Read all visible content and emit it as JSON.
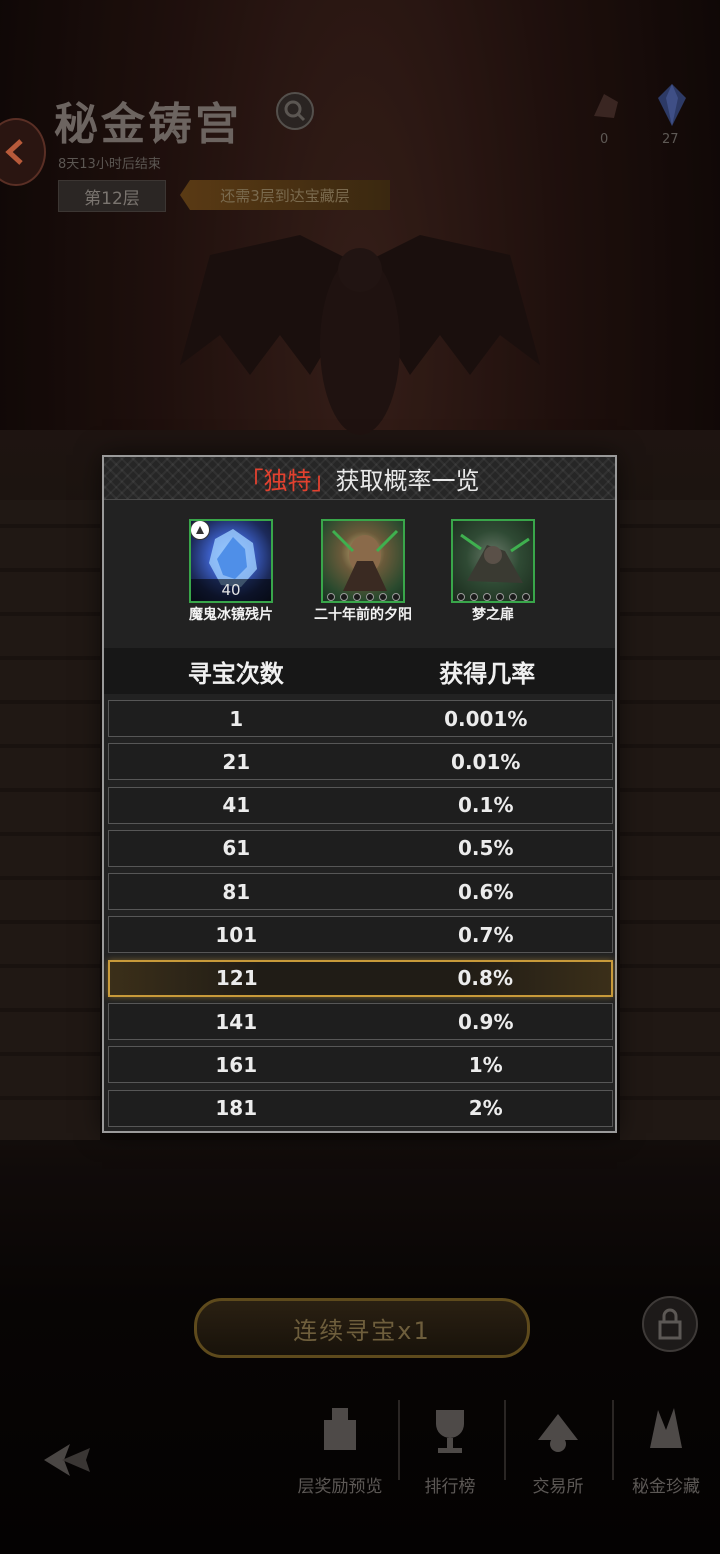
{
  "header": {
    "title": "秘金铸宫",
    "subtitle": "8天13小时后结束",
    "floor": "第12层",
    "floor_tip": "还需3层到达宝藏层",
    "resources": [
      {
        "icon": "ore-icon",
        "count": "0"
      },
      {
        "icon": "crystal-icon",
        "count": "27"
      }
    ]
  },
  "modal": {
    "title_highlight": "「独特」",
    "title_rest": "获取概率一览",
    "items": [
      {
        "name": "魔鬼冰镜残片",
        "quantity": "40",
        "icon": "ice-mirror-shard-icon"
      },
      {
        "name": "二十年前的夕阳",
        "icon": "sunset-card-icon"
      },
      {
        "name": "梦之扉",
        "icon": "dream-door-card-icon"
      }
    ],
    "column_headers": [
      "寻宝次数",
      "获得几率"
    ],
    "rows": [
      {
        "count": "1",
        "rate": "0.001%"
      },
      {
        "count": "21",
        "rate": "0.01%"
      },
      {
        "count": "41",
        "rate": "0.1%"
      },
      {
        "count": "61",
        "rate": "0.5%"
      },
      {
        "count": "81",
        "rate": "0.6%"
      },
      {
        "count": "101",
        "rate": "0.7%"
      },
      {
        "count": "121",
        "rate": "0.8%"
      },
      {
        "count": "141",
        "rate": "0.9%"
      },
      {
        "count": "161",
        "rate": "1%"
      },
      {
        "count": "181",
        "rate": "2%"
      }
    ],
    "active_row": 6
  },
  "bottom": {
    "main_button": "连续寻宝x1",
    "nav": [
      "层奖励预览",
      "排行榜",
      "交易所",
      "秘金珍藏"
    ]
  },
  "colors": {
    "accent_red": "#e2412f",
    "highlight_gold": "#c89a3a",
    "frame_green": "#39a64a"
  }
}
